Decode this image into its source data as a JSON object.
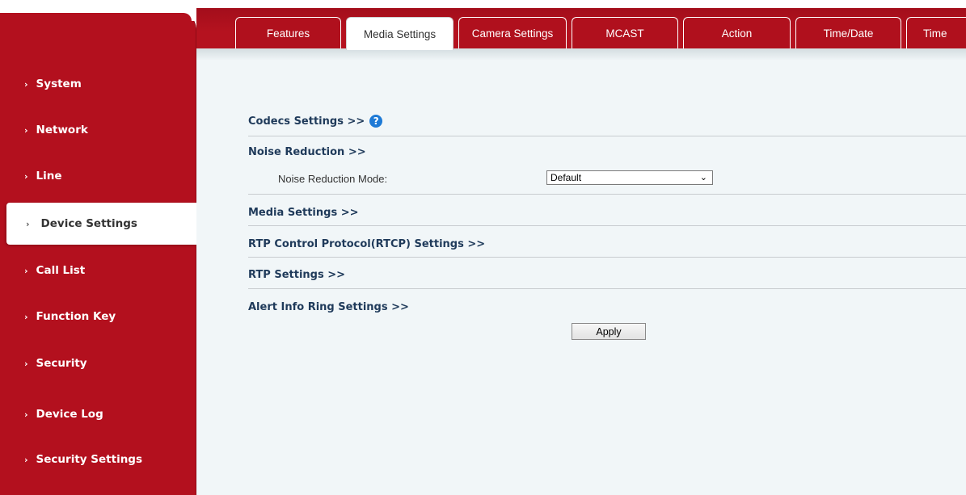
{
  "sidebar": {
    "items": [
      {
        "label": "System"
      },
      {
        "label": "Network"
      },
      {
        "label": "Line"
      },
      {
        "label": "Device Settings"
      },
      {
        "label": "Call List"
      },
      {
        "label": "Function Key"
      },
      {
        "label": "Security"
      },
      {
        "label": "Device Log"
      },
      {
        "label": "Security Settings"
      }
    ],
    "active": "Device Settings",
    "chevron": "›"
  },
  "tabs": [
    {
      "label": "Features"
    },
    {
      "label": "Media Settings"
    },
    {
      "label": "Camera Settings"
    },
    {
      "label": "MCAST"
    },
    {
      "label": "Action"
    },
    {
      "label": "Time/Date"
    },
    {
      "label": "Time"
    }
  ],
  "active_tab": "Media Settings",
  "sections": {
    "codecs": "Codecs Settings >>",
    "noise": "Noise Reduction >>",
    "media": "Media Settings >>",
    "rtcp": "RTP Control Protocol(RTCP) Settings >>",
    "rtp": "RTP Settings >>",
    "alert": "Alert Info Ring Settings >>"
  },
  "help_icon": "?",
  "noise_reduction": {
    "label": "Noise Reduction Mode:",
    "value": "Default"
  },
  "apply_label": "Apply",
  "colors": {
    "brand_red": "#b3101e",
    "link_blue": "#1e7ad6",
    "heading": "#1f3a5a"
  }
}
